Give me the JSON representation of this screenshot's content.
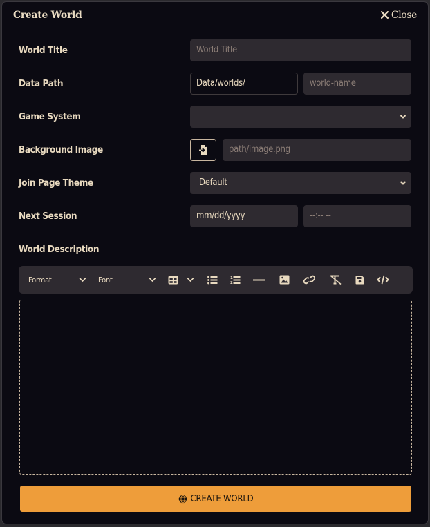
{
  "window": {
    "title": "Create World",
    "close_label": "Close"
  },
  "form": {
    "world_title": {
      "label": "World Title",
      "placeholder": "World Title"
    },
    "data_path": {
      "label": "Data Path",
      "prefix_value": "Data/worlds/",
      "name_placeholder": "world-name"
    },
    "game_system": {
      "label": "Game System",
      "selected": ""
    },
    "background_image": {
      "label": "Background Image",
      "placeholder": "path/image.png",
      "file_picker_icon": "file-import-icon"
    },
    "join_page_theme": {
      "label": "Join Page Theme",
      "selected": "Default"
    },
    "next_session": {
      "label": "Next Session",
      "date_placeholder": "mm/dd/yyyy",
      "time_placeholder": "--:-- --"
    },
    "world_description": {
      "label": "World Description",
      "content": ""
    }
  },
  "editor_toolbar": {
    "format_dropdown": "Format",
    "font_dropdown": "Font",
    "buttons": [
      "table-icon",
      "bullet-list-icon",
      "numbered-list-icon",
      "horizontal-rule-icon",
      "image-icon",
      "link-icon",
      "clear-formatting-icon",
      "save-icon",
      "source-code-icon"
    ]
  },
  "submit": {
    "label": "CREATE WORLD",
    "icon": "globe-icon",
    "color": "#ee9d3a"
  },
  "colors": {
    "background": "#0b0a12",
    "field": "#2e2a30",
    "text": "#e8d9bf",
    "placeholder": "#8b7d76",
    "divider": "#8a7a8c"
  }
}
